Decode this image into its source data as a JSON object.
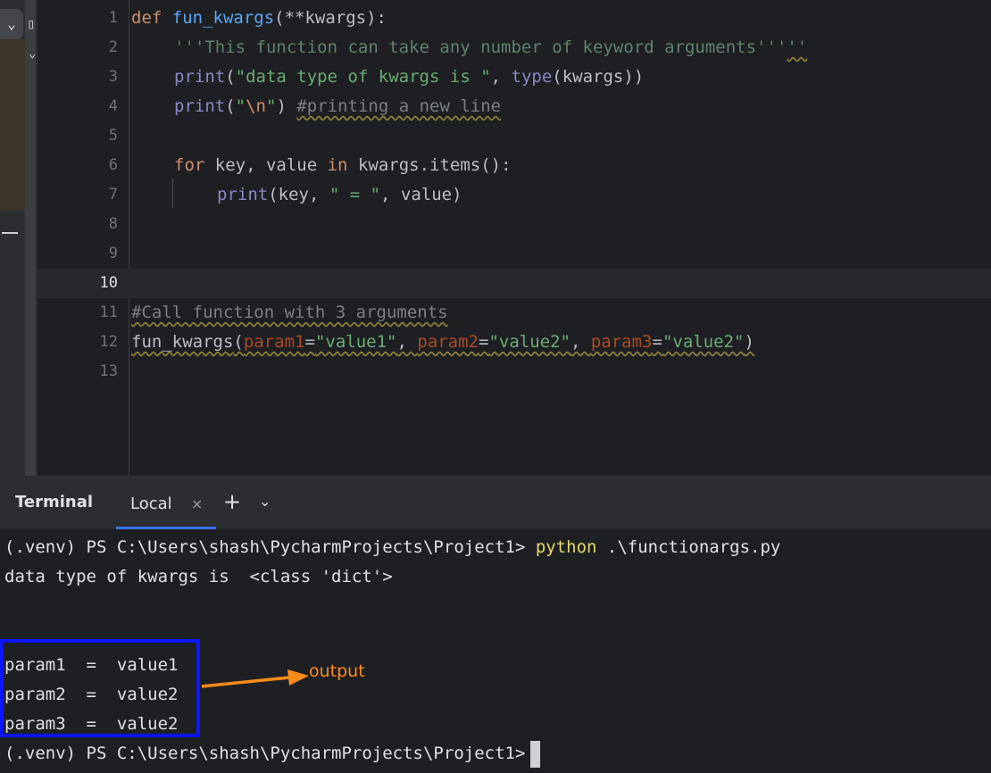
{
  "editor": {
    "lines": [
      {
        "n": "1"
      },
      {
        "n": "2"
      },
      {
        "n": "3"
      },
      {
        "n": "4"
      },
      {
        "n": "5"
      },
      {
        "n": "6"
      },
      {
        "n": "7"
      },
      {
        "n": "8"
      },
      {
        "n": "9"
      },
      {
        "n": "10"
      },
      {
        "n": "11"
      },
      {
        "n": "12"
      },
      {
        "n": "13"
      }
    ],
    "code": {
      "l1_def": "def ",
      "l1_name": "fun_kwargs",
      "l1_rest": "(**kwargs):",
      "l2_doc": "'''This function can take any number of keyword arguments'''",
      "l2_tail": "''",
      "l3_print": "print",
      "l3_open": "(",
      "l3_str": "\"data type of kwargs is \"",
      "l3_comma": ", ",
      "l3_type": "type",
      "l3_rest": "(kwargs))",
      "l4_print": "print",
      "l4_open": "(",
      "l4_q1": "\"",
      "l4_esc": "\\n",
      "l4_q2": "\"",
      "l4_close": ") ",
      "l4_cmt": "#printing a new line",
      "l6_for": "for",
      "l6_mid": " key, value ",
      "l6_in": "in",
      "l6_rest": " kwargs.items():",
      "l7_print": "print",
      "l7_open": "(key, ",
      "l7_str": "\" = \"",
      "l7_rest": ", value)",
      "l11_cmt": "#Call function with 3 arguments",
      "l12_name": "fun_kwargs",
      "l12_open": "(",
      "l12_p1": "param1",
      "l12_eq1": "=",
      "l12_v1": "\"value1\"",
      "l12_c1": ", ",
      "l12_p2": "param2",
      "l12_eq2": "=",
      "l12_v2": "\"value2\"",
      "l12_c2": ", ",
      "l12_p3": "param3",
      "l12_eq3": "=",
      "l12_v3": "\"value2\"",
      "l12_close": ")"
    }
  },
  "terminal": {
    "title": "Terminal",
    "tab_label": "Local",
    "close_glyph": "×",
    "add_glyph": "+",
    "dropdown_glyph": "⌄",
    "prompt": "(.venv) PS C:\\Users\\shash\\PycharmProjects\\Project1> ",
    "command": "python",
    "command_arg": " .\\functionargs.py",
    "output_lines": [
      "data type of kwargs is  <class 'dict'>",
      "param1  =  value1",
      "param2  =  value2",
      "param3  =  value2"
    ],
    "final_prompt": "(.venv) PS C:\\Users\\shash\\PycharmProjects\\Project1>"
  },
  "annotation": {
    "label": "output",
    "box_color": "#0b16ff",
    "arrow_color": "#ff8c1a"
  },
  "icons": {
    "left_chevron": "chevron-down-icon",
    "left_box": "panel-icon",
    "tab_close": "close-icon",
    "add_tab": "plus-icon",
    "dropdown": "chevron-down-icon"
  }
}
